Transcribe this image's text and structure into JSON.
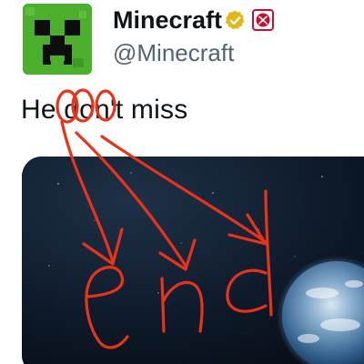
{
  "tweet": {
    "display_name": "Minecraft",
    "handle": "@Minecraft",
    "text": "He don't miss",
    "verified_icon": "gold-verified-badge-icon",
    "affiliate_icon": "xbox-affiliate-badge-icon"
  },
  "scribble": {
    "word": "end",
    "color": "#e8331b"
  },
  "colors": {
    "avatar_green": "#4caf2e",
    "text_primary": "#0f1419",
    "text_secondary": "#536471",
    "verified_gold": "#e2b719",
    "affiliate_red": "#c8102e"
  }
}
